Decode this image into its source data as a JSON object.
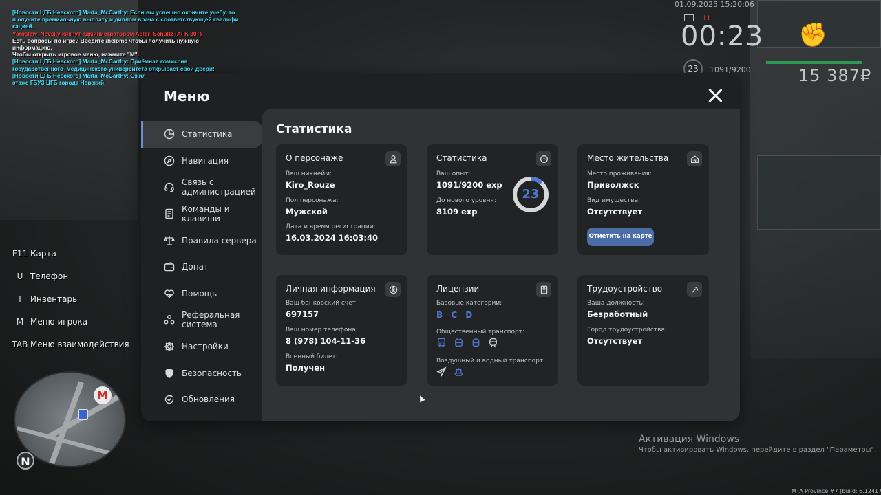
{
  "chat": [
    {
      "color": "#3fe3ff",
      "text": "[Новости ЦГБ Невского] Marta_McCarthy: Если вы успешно окончите учебу, то п олучите премиальную выплату и диплом врача с соответствующей квалифи кацией."
    },
    {
      "color": "#ff3b3b",
      "text": "Yaroslaw_Nevsky кикнут администратором Adler_Schultz (AFK 30+)"
    },
    {
      "color": "#f2f2f2",
      "text": "Есть вопросы по игре? Введите /helpme чтобы получить нужную информацию."
    },
    {
      "color": "#f2f2f2",
      "text": "Чтобы открыть игровое меню, нажмите \"M\"."
    },
    {
      "color": "#3fe3ff",
      "text": "[Новости ЦГБ Невского] Marta_McCarthy: Приёмная комиссия государственного  медицинского университета открывает свои двери!"
    },
    {
      "color": "#3fe3ff",
      "text": "[Новости ЦГБ Невского] Marta_McCarthy: Ожидаем всех желающих на пятом  этаже ГБУЗ ЦГБ города Невский."
    }
  ],
  "hud": {
    "datetime": "01.09.2025 15:20:06",
    "signal": "!!",
    "time": "00:23",
    "level": "23",
    "exp": "1091/9200",
    "money": "15 387₽",
    "hp_color": "#2c9a52"
  },
  "hotkeys": [
    {
      "key": "F11",
      "action": "Карта"
    },
    {
      "key": "U",
      "action": "Телефон"
    },
    {
      "key": "I",
      "action": "Инвентарь"
    },
    {
      "key": "M",
      "action": "Меню игрока"
    },
    {
      "key": "TAB",
      "action": "Меню взаимодействия"
    }
  ],
  "minimap": {
    "metro": "M",
    "north": "N"
  },
  "watermark": {
    "title": "Активация Windows",
    "subtitle": "Чтобы активировать Windows, перейдите в раздел \"Параметры\".",
    "build": "MTA Province #7 (build: 6.12417.9)"
  },
  "menu": {
    "title": "Меню",
    "accent": "#4f78cf",
    "nav": [
      {
        "icon": "stats-icon",
        "label": "Статистика",
        "active": true
      },
      {
        "icon": "compass-icon",
        "label": "Навигация"
      },
      {
        "icon": "headset-icon",
        "label": "Связь с\nадминистрацией"
      },
      {
        "icon": "document-icon",
        "label": "Команды и\nклавиши"
      },
      {
        "icon": "scales-icon",
        "label": "Правила сервера"
      },
      {
        "icon": "wallet-icon",
        "label": "Донат"
      },
      {
        "icon": "heart-hands-icon",
        "label": "Помощь"
      },
      {
        "icon": "referral-icon",
        "label": "Реферальная\nсистема"
      },
      {
        "icon": "gear-icon",
        "label": "Настройки"
      },
      {
        "icon": "shield-icon",
        "label": "Безопасность"
      },
      {
        "icon": "update-icon",
        "label": "Обновления"
      }
    ],
    "content_title": "Статистика",
    "cards": {
      "character": {
        "title": "О персонаже",
        "nickname_label": "Ваш никнейм:",
        "nickname": "Kiro_Rouze",
        "gender_label": "Пол персонажа:",
        "gender": "Мужской",
        "reg_label": "Дата и время регистрации:",
        "reg_date": "16.03.2024 16:03:40"
      },
      "stats": {
        "title": "Статистика",
        "exp_label": "Ваш опыт:",
        "exp": "1091/9200 exp",
        "next_label": "До нового уровня:",
        "next": "8109 exp",
        "level": "23",
        "progress": 0.1186
      },
      "residence": {
        "title": "Место жительства",
        "place_label": "Место проживания:",
        "place": "Приволжск",
        "property_label": "Вид имущества:",
        "property": "Отсутствует",
        "map_button": "Отметить на карте"
      },
      "personal": {
        "title": "Личная информация",
        "bank_label": "Ваш банковский счет:",
        "bank": "697157",
        "phone_label": "Ваш номер телефона:",
        "phone": "8 (978) 104-11-36",
        "military_label": "Военный билет:",
        "military": "Получен"
      },
      "licenses": {
        "title": "Лицензии",
        "base_label": "Базовые категории:",
        "base": "B C D",
        "public_label": "Общественный транспорт:",
        "public_icons": [
          "bus-icon",
          "trolleybus-icon",
          "tram-icon",
          "train-icon"
        ],
        "air_label": "Воздушный и водный транспорт:",
        "air_icons": [
          "plane-icon",
          "boat-icon"
        ]
      },
      "job": {
        "title": "Трудоустройство",
        "position_label": "Ваша должность:",
        "position": "Безработный",
        "city_label": "Город трудоустройства:",
        "city": "Отсутствует"
      }
    }
  }
}
